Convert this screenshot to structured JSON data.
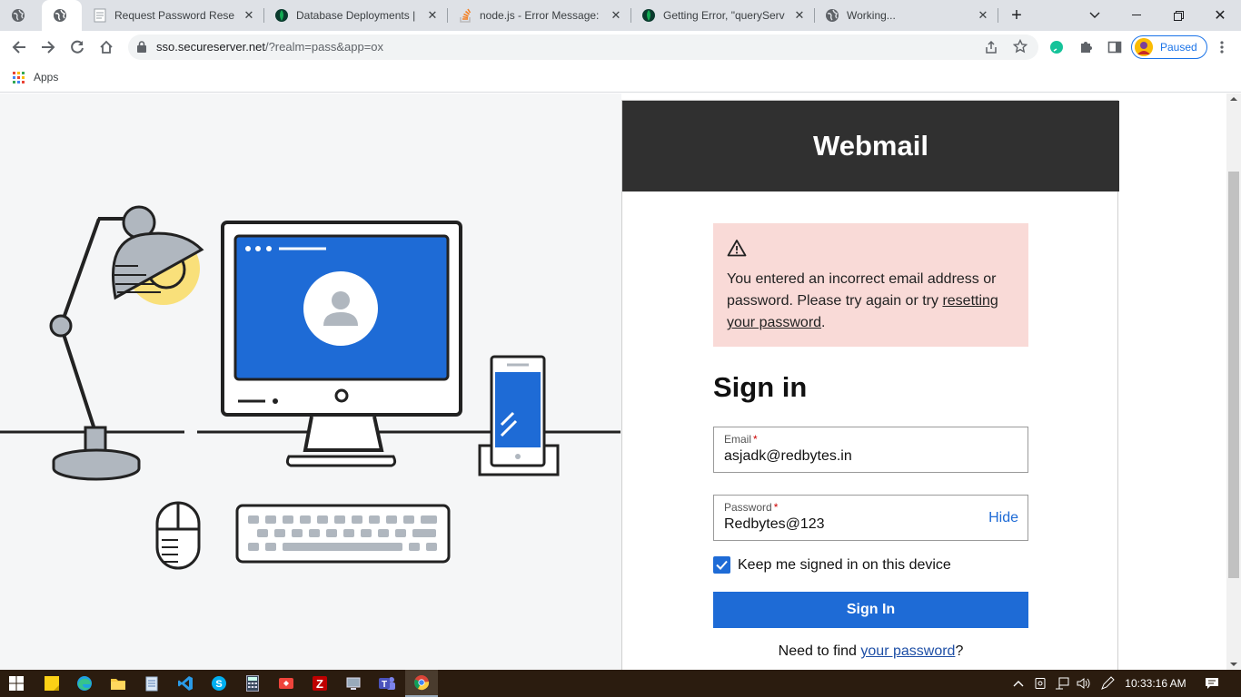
{
  "browser": {
    "tabs": [
      {
        "title": "",
        "icon": "globe-icon"
      },
      {
        "title": "",
        "icon": "globe-icon",
        "active": true
      },
      {
        "title": "Request Password Reset",
        "icon": "document-icon"
      },
      {
        "title": "Database Deployments | Cl",
        "icon": "mongodb-leaf-icon"
      },
      {
        "title": "node.js - Error Message: M",
        "icon": "stackoverflow-icon"
      },
      {
        "title": "Getting Error, \"queryServ",
        "icon": "mongodb-leaf-icon"
      },
      {
        "title": "Working...",
        "icon": "globe-icon"
      }
    ],
    "url_host": "sso.secureserver.net",
    "url_path": "/?realm=pass&app=ox",
    "profile_status": "Paused",
    "bookmark_apps": "Apps"
  },
  "page": {
    "header_title": "Webmail",
    "alert": {
      "text_before": "You entered an incorrect email address or password. Please try again or try ",
      "link_text": "resetting your password",
      "text_after": "."
    },
    "heading": "Sign in",
    "email": {
      "label": "Email",
      "required_mark": "*",
      "value": "asjadk@redbytes.in"
    },
    "password": {
      "label": "Password",
      "required_mark": "*",
      "value": "Redbytes@123",
      "toggle_label": "Hide"
    },
    "keep_signed_in": {
      "label": "Keep me signed in on this device",
      "checked": true
    },
    "submit_label": "Sign In",
    "find_text": "Need to find ",
    "find_link": "your password",
    "find_suffix": "?"
  },
  "taskbar": {
    "apps": [
      "windows-start-icon",
      "sticky-notes-icon",
      "edge-icon",
      "file-explorer-icon",
      "notepad-icon",
      "vscode-icon",
      "skype-icon",
      "calculator-icon",
      "anydesk-icon",
      "filezilla-icon",
      "network-app-icon",
      "teams-icon",
      "chrome-icon"
    ],
    "clock": "10:33:16 AM"
  },
  "colors": {
    "header_bg": "#303030",
    "alert_bg": "#f9dad7",
    "primary_blue": "#1e6bd6",
    "taskbar_bg": "#2b1c0f"
  }
}
